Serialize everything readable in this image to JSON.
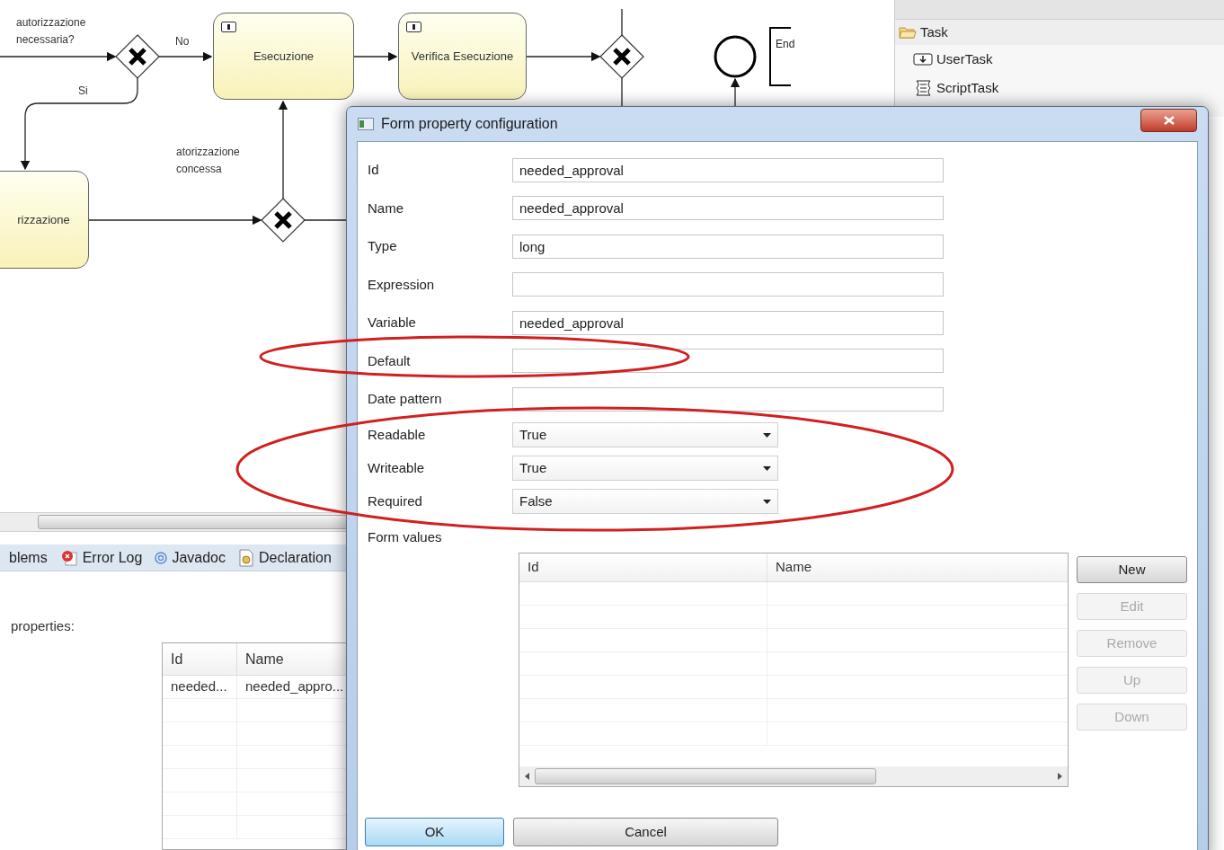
{
  "diagram": {
    "tasks": [
      {
        "label": "Esecuzione"
      },
      {
        "label": "Verifica Esecuzione"
      },
      {
        "label": "rizzazione"
      }
    ],
    "flow_labels": [
      "autorizzazione necessaria?",
      "No",
      "Si",
      "atorizzazione concessa"
    ],
    "end_annotation": "End"
  },
  "palette": {
    "folder": "Task",
    "items": [
      {
        "label": "UserTask",
        "kind": "user"
      },
      {
        "label": "ScriptTask",
        "kind": "script"
      }
    ]
  },
  "bottom_panel": {
    "tabs": [
      {
        "label": "blems",
        "kind": "problems"
      },
      {
        "label": "Error Log",
        "kind": "error-log"
      },
      {
        "label": "Javadoc",
        "kind": "javadoc"
      },
      {
        "label": "Declaration",
        "kind": "declaration"
      }
    ],
    "properties_label": "properties:",
    "table": {
      "columns": [
        "Id",
        "Name"
      ],
      "rows": [
        [
          "needed...",
          "needed_appro..."
        ]
      ]
    }
  },
  "dialog": {
    "title": "Form property configuration",
    "fields": [
      {
        "label": "Id",
        "kind": "text",
        "value": "needed_approval"
      },
      {
        "label": "Name",
        "kind": "text",
        "value": "needed_approval"
      },
      {
        "label": "Type",
        "kind": "text",
        "value": "long"
      },
      {
        "label": "Expression",
        "kind": "text"
      },
      {
        "label": "Variable",
        "kind": "text",
        "value": "needed_approval"
      },
      {
        "label": "Default",
        "kind": "text"
      },
      {
        "label": "Date pattern",
        "kind": "text"
      },
      {
        "label": "Readable",
        "kind": "select",
        "value": "True"
      },
      {
        "label": "Writeable",
        "kind": "select",
        "value": "True"
      },
      {
        "label": "Required",
        "kind": "select",
        "value": "False"
      }
    ],
    "form_values": {
      "label": "Form values",
      "columns": [
        "Id",
        "Name"
      ]
    },
    "side_buttons": [
      {
        "label": "New",
        "disabled": false
      },
      {
        "label": "Edit",
        "disabled": true
      },
      {
        "label": "Remove",
        "disabled": true
      },
      {
        "label": "Up",
        "disabled": true
      },
      {
        "label": "Down",
        "disabled": true
      }
    ],
    "buttons": [
      {
        "label": "OK",
        "default": true
      },
      {
        "label": "Cancel",
        "default": false
      }
    ]
  }
}
